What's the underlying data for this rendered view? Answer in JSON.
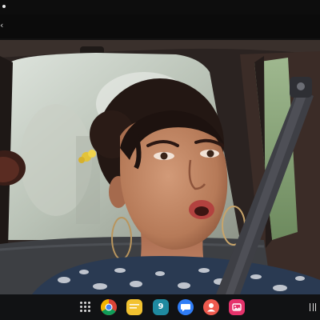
{
  "status_bar": {
    "indicator_icon": "notification-dot-icon"
  },
  "header": {
    "back_icon": "back-arrow-icon",
    "back_glyph": "‹"
  },
  "video": {
    "content": "video-frame"
  },
  "taskbar": {
    "apps_button_icon": "apps-grid-icon",
    "apps": [
      {
        "name": "chrome",
        "icon": "chrome-icon",
        "color": "#4285f4"
      },
      {
        "name": "notes",
        "icon": "notes-icon",
        "color": "#f2c230"
      },
      {
        "name": "calendar",
        "icon": "calendar-icon",
        "color": "#1f8aa0",
        "label": "9"
      },
      {
        "name": "messages",
        "icon": "messages-icon",
        "color": "#2f7df6"
      },
      {
        "name": "contacts",
        "icon": "contacts-icon",
        "color": "#ef5a4e"
      },
      {
        "name": "gallery",
        "icon": "gallery-icon",
        "color": "#e5336b"
      }
    ],
    "recents_icon": "recents-icon"
  }
}
